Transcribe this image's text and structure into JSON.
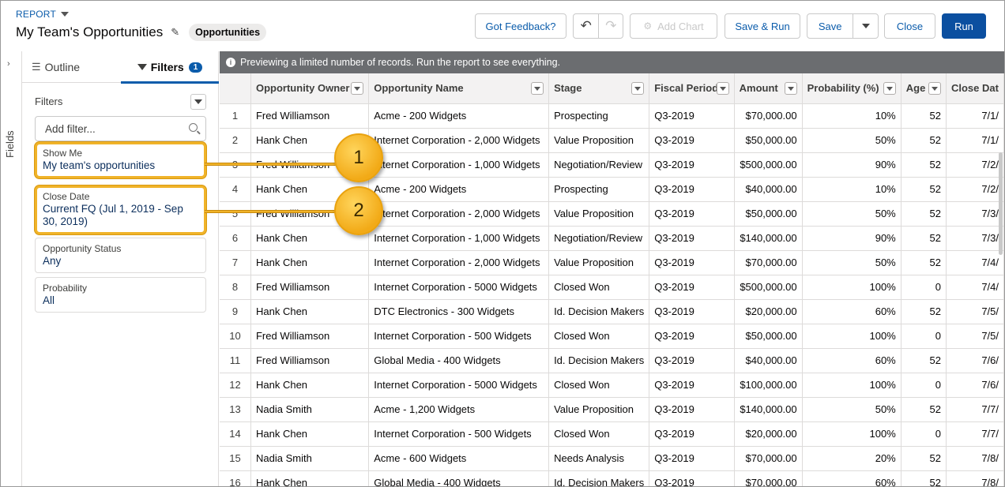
{
  "header": {
    "report_label": "REPORT",
    "title": "My Team's Opportunities",
    "type_pill": "Opportunities",
    "buttons": {
      "feedback": "Got Feedback?",
      "undo": "↶",
      "redo": "↷",
      "add_chart": "Add Chart",
      "save_run": "Save & Run",
      "save": "Save",
      "close": "Close",
      "run": "Run"
    }
  },
  "fields_strip": {
    "label": "Fields"
  },
  "side_panel": {
    "tabs": {
      "outline": "Outline",
      "filters": "Filters",
      "filters_count": "1"
    },
    "filters_heading": "Filters",
    "add_filter_placeholder": "Add filter...",
    "filters": [
      {
        "name": "Show Me",
        "value": "My team's opportunities"
      },
      {
        "name": "Close Date",
        "value": "Current FQ (Jul 1, 2019 - Sep 30, 2019)"
      },
      {
        "name": "Opportunity Status",
        "value": "Any"
      },
      {
        "name": "Probability",
        "value": "All"
      }
    ]
  },
  "preview_bar": {
    "text": "Previewing a limited number of records. Run the report to see everything."
  },
  "table": {
    "columns": [
      "Opportunity Owner",
      "Opportunity Name",
      "Stage",
      "Fiscal Period",
      "Amount",
      "Probability (%)",
      "Age",
      "Close Dat"
    ],
    "rows": [
      [
        "1",
        "Fred Williamson",
        "Acme - 200 Widgets",
        "Prospecting",
        "Q3-2019",
        "$70,000.00",
        "10%",
        "52",
        "7/1/"
      ],
      [
        "2",
        "Hank Chen",
        "Internet Corporation - 2,000 Widgets",
        "Value Proposition",
        "Q3-2019",
        "$50,000.00",
        "50%",
        "52",
        "7/1/"
      ],
      [
        "3",
        "Fred Williamson",
        "Internet Corporation - 1,000 Widgets",
        "Negotiation/Review",
        "Q3-2019",
        "$500,000.00",
        "90%",
        "52",
        "7/2/"
      ],
      [
        "4",
        "Hank Chen",
        "Acme - 200 Widgets",
        "Prospecting",
        "Q3-2019",
        "$40,000.00",
        "10%",
        "52",
        "7/2/"
      ],
      [
        "5",
        "Fred Williamson",
        "Internet Corporation - 2,000 Widgets",
        "Value Proposition",
        "Q3-2019",
        "$50,000.00",
        "50%",
        "52",
        "7/3/"
      ],
      [
        "6",
        "Hank Chen",
        "Internet Corporation - 1,000 Widgets",
        "Negotiation/Review",
        "Q3-2019",
        "$140,000.00",
        "90%",
        "52",
        "7/3/"
      ],
      [
        "7",
        "Hank Chen",
        "Internet Corporation - 2,000 Widgets",
        "Value Proposition",
        "Q3-2019",
        "$70,000.00",
        "50%",
        "52",
        "7/4/"
      ],
      [
        "8",
        "Fred Williamson",
        "Internet Corporation - 5000 Widgets",
        "Closed Won",
        "Q3-2019",
        "$500,000.00",
        "100%",
        "0",
        "7/4/"
      ],
      [
        "9",
        "Hank Chen",
        "DTC Electronics - 300 Widgets",
        "Id. Decision Makers",
        "Q3-2019",
        "$20,000.00",
        "60%",
        "52",
        "7/5/"
      ],
      [
        "10",
        "Fred Williamson",
        "Internet Corporation - 500 Widgets",
        "Closed Won",
        "Q3-2019",
        "$50,000.00",
        "100%",
        "0",
        "7/5/"
      ],
      [
        "11",
        "Fred Williamson",
        "Global Media - 400 Widgets",
        "Id. Decision Makers",
        "Q3-2019",
        "$40,000.00",
        "60%",
        "52",
        "7/6/"
      ],
      [
        "12",
        "Hank Chen",
        "Internet Corporation - 5000 Widgets",
        "Closed Won",
        "Q3-2019",
        "$100,000.00",
        "100%",
        "0",
        "7/6/"
      ],
      [
        "13",
        "Nadia Smith",
        "Acme - 1,200 Widgets",
        "Value Proposition",
        "Q3-2019",
        "$140,000.00",
        "50%",
        "52",
        "7/7/"
      ],
      [
        "14",
        "Hank Chen",
        "Internet Corporation - 500 Widgets",
        "Closed Won",
        "Q3-2019",
        "$20,000.00",
        "100%",
        "0",
        "7/7/"
      ],
      [
        "15",
        "Nadia Smith",
        "Acme - 600 Widgets",
        "Needs Analysis",
        "Q3-2019",
        "$70,000.00",
        "20%",
        "52",
        "7/8/"
      ],
      [
        "16",
        "Hank Chen",
        "Global Media - 400 Widgets",
        "Id. Decision Makers",
        "Q3-2019",
        "$70,000.00",
        "60%",
        "52",
        "7/8/"
      ]
    ]
  },
  "callouts": [
    "1",
    "2"
  ],
  "colors": {
    "accent": "#0b5cab",
    "callout": "#f0b329",
    "preview_bar": "#6b6d70"
  }
}
